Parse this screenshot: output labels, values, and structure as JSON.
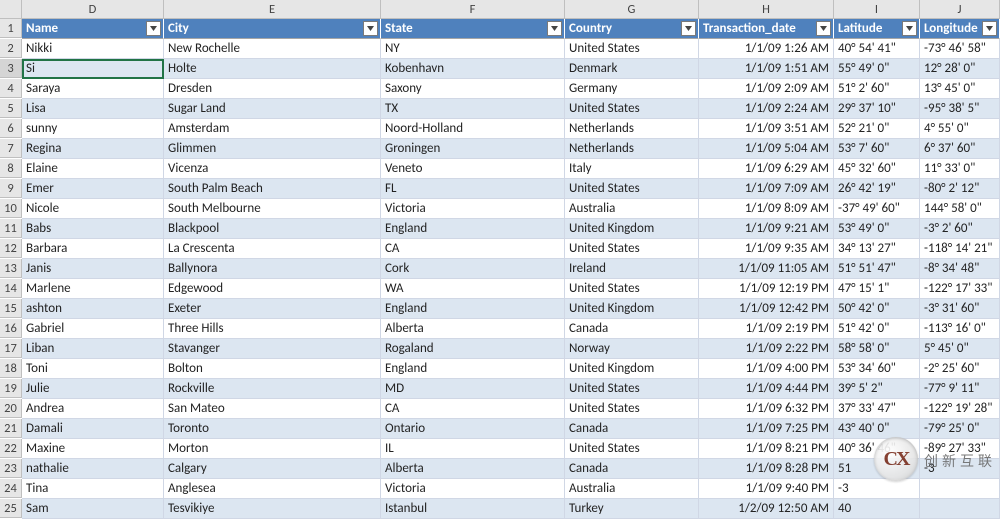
{
  "columns": [
    "D",
    "E",
    "F",
    "G",
    "H",
    "I",
    "J"
  ],
  "selected_row_index": 3,
  "selected_col_index": 0,
  "headers": [
    "Name",
    "City",
    "State",
    "Country",
    "Transaction_date",
    "Latitude",
    "Longitude"
  ],
  "rows": [
    {
      "n": "2",
      "Name": "Nikki",
      "City": "New Rochelle",
      "State": "NY",
      "Country": "United States",
      "Transaction_date": "1/1/09 1:26 AM",
      "Latitude": "40° 54'  41\"",
      "Longitude": "-73° 46'  58\""
    },
    {
      "n": "3",
      "Name": "Si",
      "City": "Holte",
      "State": "Kobenhavn",
      "Country": "Denmark",
      "Transaction_date": "1/1/09 1:51 AM",
      "Latitude": "55° 49'  0\"",
      "Longitude": "12° 28'  0\""
    },
    {
      "n": "4",
      "Name": "Saraya",
      "City": "Dresden",
      "State": "Saxony",
      "Country": "Germany",
      "Transaction_date": "1/1/09 2:09 AM",
      "Latitude": "51° 2'  60\"",
      "Longitude": "13° 45'  0\""
    },
    {
      "n": "5",
      "Name": "Lisa",
      "City": "Sugar Land",
      "State": "TX",
      "Country": "United States",
      "Transaction_date": "1/1/09 2:24 AM",
      "Latitude": "29° 37'  10\"",
      "Longitude": "-95° 38'  5\""
    },
    {
      "n": "6",
      "Name": "sunny",
      "City": "Amsterdam",
      "State": "Noord-Holland",
      "Country": "Netherlands",
      "Transaction_date": "1/1/09 3:51 AM",
      "Latitude": "52° 21'  0\"",
      "Longitude": "4° 55'  0\""
    },
    {
      "n": "7",
      "Name": "Regina",
      "City": "Glimmen",
      "State": "Groningen",
      "Country": "Netherlands",
      "Transaction_date": "1/1/09 5:04 AM",
      "Latitude": "53° 7'  60\"",
      "Longitude": "6° 37'  60\""
    },
    {
      "n": "8",
      "Name": "Elaine",
      "City": "Vicenza",
      "State": "Veneto",
      "Country": "Italy",
      "Transaction_date": "1/1/09 6:29 AM",
      "Latitude": "45° 32'  60\"",
      "Longitude": "11° 33'  0\""
    },
    {
      "n": "9",
      "Name": "Emer",
      "City": "South Palm Beach",
      "State": "FL",
      "Country": "United States",
      "Transaction_date": "1/1/09 7:09 AM",
      "Latitude": "26° 42'  19\"",
      "Longitude": "-80° 2'  12\""
    },
    {
      "n": "10",
      "Name": "Nicole",
      "City": "South Melbourne",
      "State": "Victoria",
      "Country": "Australia",
      "Transaction_date": "1/1/09 8:09 AM",
      "Latitude": "-37° 49'  60\"",
      "Longitude": "144° 58'  0\""
    },
    {
      "n": "11",
      "Name": "Babs",
      "City": "Blackpool",
      "State": "England",
      "Country": "United Kingdom",
      "Transaction_date": "1/1/09 9:21 AM",
      "Latitude": "53° 49'  0\"",
      "Longitude": "-3° 2'  60\""
    },
    {
      "n": "12",
      "Name": "Barbara",
      "City": "La Crescenta",
      "State": "CA",
      "Country": "United States",
      "Transaction_date": "1/1/09 9:35 AM",
      "Latitude": "34° 13'  27\"",
      "Longitude": "-118° 14'  21\""
    },
    {
      "n": "13",
      "Name": "Janis",
      "City": "Ballynora",
      "State": "Cork",
      "Country": "Ireland",
      "Transaction_date": "1/1/09 11:05 AM",
      "Latitude": "51° 51'  47\"",
      "Longitude": "-8° 34'  48\""
    },
    {
      "n": "14",
      "Name": "Marlene",
      "City": "Edgewood",
      "State": "WA",
      "Country": "United States",
      "Transaction_date": "1/1/09 12:19 PM",
      "Latitude": "47° 15'  1\"",
      "Longitude": "-122° 17'  33\""
    },
    {
      "n": "15",
      "Name": "ashton",
      "City": "Exeter",
      "State": "England",
      "Country": "United Kingdom",
      "Transaction_date": "1/1/09 12:42 PM",
      "Latitude": "50° 42'  0\"",
      "Longitude": "-3° 31'  60\""
    },
    {
      "n": "16",
      "Name": "Gabriel",
      "City": "Three Hills",
      "State": "Alberta",
      "Country": "Canada",
      "Transaction_date": "1/1/09 2:19 PM",
      "Latitude": "51° 42'  0\"",
      "Longitude": "-113° 16'  0\""
    },
    {
      "n": "17",
      "Name": "Liban",
      "City": "Stavanger",
      "State": "Rogaland",
      "Country": "Norway",
      "Transaction_date": "1/1/09 2:22 PM",
      "Latitude": "58° 58'  0\"",
      "Longitude": "5° 45'  0\""
    },
    {
      "n": "18",
      "Name": "Toni",
      "City": "Bolton",
      "State": "England",
      "Country": "United Kingdom",
      "Transaction_date": "1/1/09 4:00 PM",
      "Latitude": "53° 34'  60\"",
      "Longitude": "-2° 25'  60\""
    },
    {
      "n": "19",
      "Name": "Julie",
      "City": "Rockville",
      "State": "MD",
      "Country": "United States",
      "Transaction_date": "1/1/09 4:44 PM",
      "Latitude": "39° 5'  2\"",
      "Longitude": "-77° 9'  11\""
    },
    {
      "n": "20",
      "Name": "Andrea",
      "City": "San Mateo",
      "State": "CA",
      "Country": "United States",
      "Transaction_date": "1/1/09 6:32 PM",
      "Latitude": "37° 33'  47\"",
      "Longitude": "-122° 19'  28\""
    },
    {
      "n": "21",
      "Name": "Damali",
      "City": "Toronto",
      "State": "Ontario",
      "Country": "Canada",
      "Transaction_date": "1/1/09 7:25 PM",
      "Latitude": "43° 40'  0\"",
      "Longitude": "-79° 25'  0\""
    },
    {
      "n": "22",
      "Name": "Maxine",
      "City": "Morton",
      "State": "IL",
      "Country": "United States",
      "Transaction_date": "1/1/09 8:21 PM",
      "Latitude": "40° 36'  46\"",
      "Longitude": "-89° 27'  33\""
    },
    {
      "n": "23",
      "Name": "nathalie",
      "City": "Calgary",
      "State": "Alberta",
      "Country": "Canada",
      "Transaction_date": "1/1/09 8:28 PM",
      "Latitude": "51",
      "Longitude": "-3"
    },
    {
      "n": "24",
      "Name": "Tina",
      "City": "Anglesea",
      "State": "Victoria",
      "Country": "Australia",
      "Transaction_date": "1/1/09 9:40 PM",
      "Latitude": "-3",
      "Longitude": ""
    },
    {
      "n": "25",
      "Name": "Sam",
      "City": "Tesvikiye",
      "State": "Istanbul",
      "Country": "Turkey",
      "Transaction_date": "1/2/09 12:50 AM",
      "Latitude": "40",
      "Longitude": ""
    }
  ],
  "watermark": {
    "logo_text": "CX",
    "label": "创新互联"
  }
}
